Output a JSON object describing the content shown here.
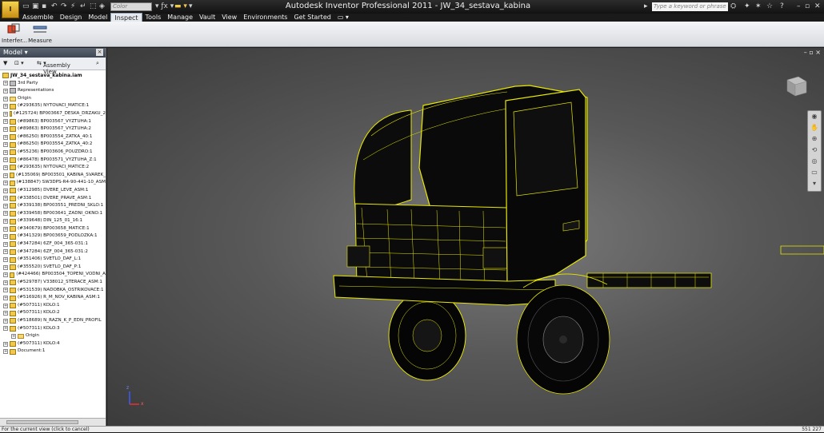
{
  "titlebar": {
    "logo_label": "I",
    "logo_sub": "PRO",
    "color_placeholder": "Color",
    "title": "Autodesk Inventor Professional 2011 - JW_34_sestava_kabina",
    "search_placeholder": "Type a keyword or phrase"
  },
  "ribbon": {
    "tabs": [
      "Assemble",
      "Design",
      "Model",
      "Inspect",
      "Tools",
      "Manage",
      "Vault",
      "View",
      "Environments",
      "Get Started"
    ],
    "active_tab": "Inspect",
    "buttons": [
      {
        "label": "Interfer..."
      },
      {
        "label": "Measure"
      }
    ]
  },
  "browser": {
    "header": "Model",
    "view_label": "Assembly View",
    "root": "JW_34_sestava_kabina.iam",
    "items": [
      {
        "label": "3rd Party",
        "icon": "gray"
      },
      {
        "label": "Representations",
        "icon": "gray"
      },
      {
        "label": "Origin",
        "icon": "folder"
      },
      {
        "label": "(#293635) NYTOVACI_MATICE:1",
        "icon": "part"
      },
      {
        "label": "(#125724) BP003667_DESKA_DRZAKU_2",
        "icon": "part"
      },
      {
        "label": "(#89863) BP003567_VYZTUHA:1",
        "icon": "part"
      },
      {
        "label": "(#89863) BP003567_VYZTUHA:2",
        "icon": "part"
      },
      {
        "label": "(#86250) BP003554_ZATKA_40:1",
        "icon": "part"
      },
      {
        "label": "(#86250) BP003554_ZATKA_40:2",
        "icon": "part"
      },
      {
        "label": "(#55236) BP003606_POUZDRO:1",
        "icon": "part"
      },
      {
        "label": "(#86478) BP003571_VYZTUHA_Z:1",
        "icon": "part"
      },
      {
        "label": "(#293635) NYTOVACI_MATICE:2",
        "icon": "part"
      },
      {
        "label": "(#135069) BP003501_KABINA_SVAREK_",
        "icon": "asm"
      },
      {
        "label": "(#138847) SW3DPS-R4-90-441-10_ASM",
        "icon": "asm"
      },
      {
        "label": "(#312985) DVERE_LEVE_ASM:1",
        "icon": "asm"
      },
      {
        "label": "(#338501) DVERE_PRAVE_ASM:1",
        "icon": "asm"
      },
      {
        "label": "(#339138) BP003551_PREDNI_SKLO:1",
        "icon": "part"
      },
      {
        "label": "(#339458) BP003641_ZADNI_OKNO:1",
        "icon": "part"
      },
      {
        "label": "(#339648) DIN_125_01_16:1",
        "icon": "part"
      },
      {
        "label": "(#340679) BP003658_MATICE:1",
        "icon": "part"
      },
      {
        "label": "(#341329) BP003659_PODLOZKA:1",
        "icon": "part"
      },
      {
        "label": "(#347284) 6ZF_004_365-031:1",
        "icon": "part"
      },
      {
        "label": "(#347284) 6ZF_004_365-031:2",
        "icon": "part"
      },
      {
        "label": "(#351406) SVETLO_DAF_L:1",
        "icon": "part"
      },
      {
        "label": "(#355520) SVETLO_DAF_P:1",
        "icon": "part"
      },
      {
        "label": "(#424466) BP003504_TOPENI_VODNI_A",
        "icon": "asm"
      },
      {
        "label": "(#529787) V338012_STERACE_ASM:1",
        "icon": "asm"
      },
      {
        "label": "(#531539) NADOBKA_OSTRIKOVACE:1",
        "icon": "part"
      },
      {
        "label": "(#516926) R_M_NOV_KABINA_ASM:1",
        "icon": "asm"
      },
      {
        "label": "(#507311) KOLO:1",
        "icon": "part"
      },
      {
        "label": "(#507311) KOLO:2",
        "icon": "part"
      },
      {
        "label": "(#518689) N_RAZN_K_P_EDN_PROFIL",
        "icon": "part"
      },
      {
        "label": "(#507311) KOLO:3",
        "icon": "part"
      },
      {
        "label": "Origin",
        "icon": "folder",
        "indent": 1
      },
      {
        "label": "(#507311) KOLO:4",
        "icon": "part"
      },
      {
        "label": "Document:1",
        "icon": "doc"
      }
    ]
  },
  "statusbar": {
    "left": "For the current view (click to cancel)",
    "right": "551     227"
  },
  "colors": {
    "highlight": "#e8e800",
    "ribbon_active": "#e6e9ee"
  }
}
